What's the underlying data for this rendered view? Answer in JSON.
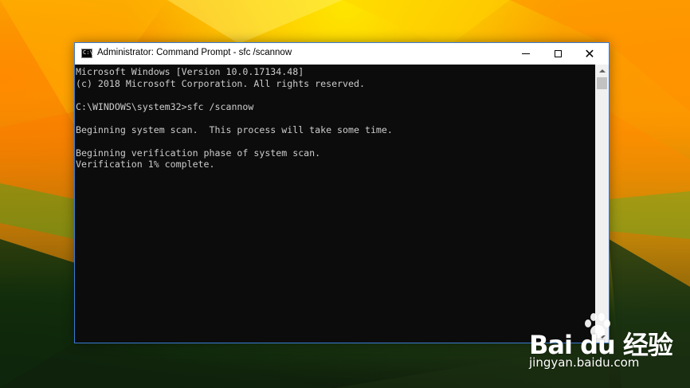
{
  "window": {
    "title": "Administrator: Command Prompt - sfc  /scannow",
    "icon": "command-prompt-icon",
    "icon_glyph": "C:\\",
    "controls": {
      "minimize": "minimize-icon",
      "maximize": "maximize-icon",
      "close": "close-icon"
    }
  },
  "console": {
    "background": "#0c0c0c",
    "text_color": "#cccccc",
    "lines": [
      "Microsoft Windows [Version 10.0.17134.48]",
      "(c) 2018 Microsoft Corporation. All rights reserved.",
      "",
      "C:\\WINDOWS\\system32>sfc /scannow",
      "",
      "Beginning system scan.  This process will take some time.",
      "",
      "Beginning verification phase of system scan.",
      "Verification 1% complete."
    ]
  },
  "scrollbar": {
    "up": "scroll-up-icon",
    "down": "scroll-down-icon"
  },
  "watermark": {
    "logo": "Bai du 经验",
    "url": "jingyan.baidu.com"
  },
  "colors": {
    "wallpaper_top": "#f6c400",
    "wallpaper_mid": "#e98a00",
    "wallpaper_green": "#2d6a15",
    "wallpaper_bottom": "#0e1a0b",
    "window_border": "#3a7bd5"
  }
}
